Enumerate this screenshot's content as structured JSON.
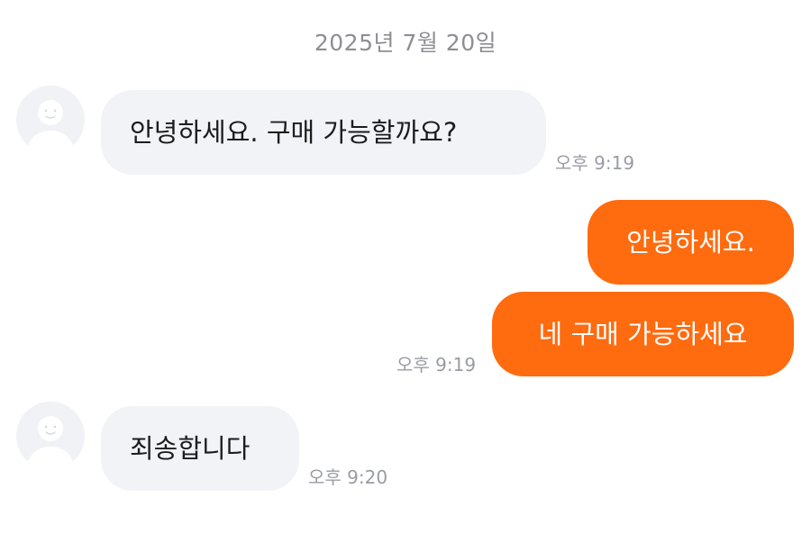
{
  "date_header": "2025년 7월 20일",
  "messages": [
    {
      "direction": "incoming",
      "text": "안녕하세요. 구매 가능할까요?",
      "time": "오후 9:19"
    },
    {
      "direction": "outgoing",
      "text": "안녕하세요."
    },
    {
      "direction": "outgoing",
      "text": "네 구매 가능하세요",
      "time": "오후 9:19"
    },
    {
      "direction": "incoming",
      "text": "죄송합니다",
      "time": "오후 9:20"
    }
  ],
  "icons": {
    "avatar": "default-user-avatar-icon"
  },
  "colors": {
    "outgoing_bubble": "#ff6b0f",
    "incoming_bubble": "#f2f3f7",
    "avatar_bg": "#f1f2f6",
    "timestamp": "#9a9ca3",
    "date_text": "#8e8e93"
  }
}
